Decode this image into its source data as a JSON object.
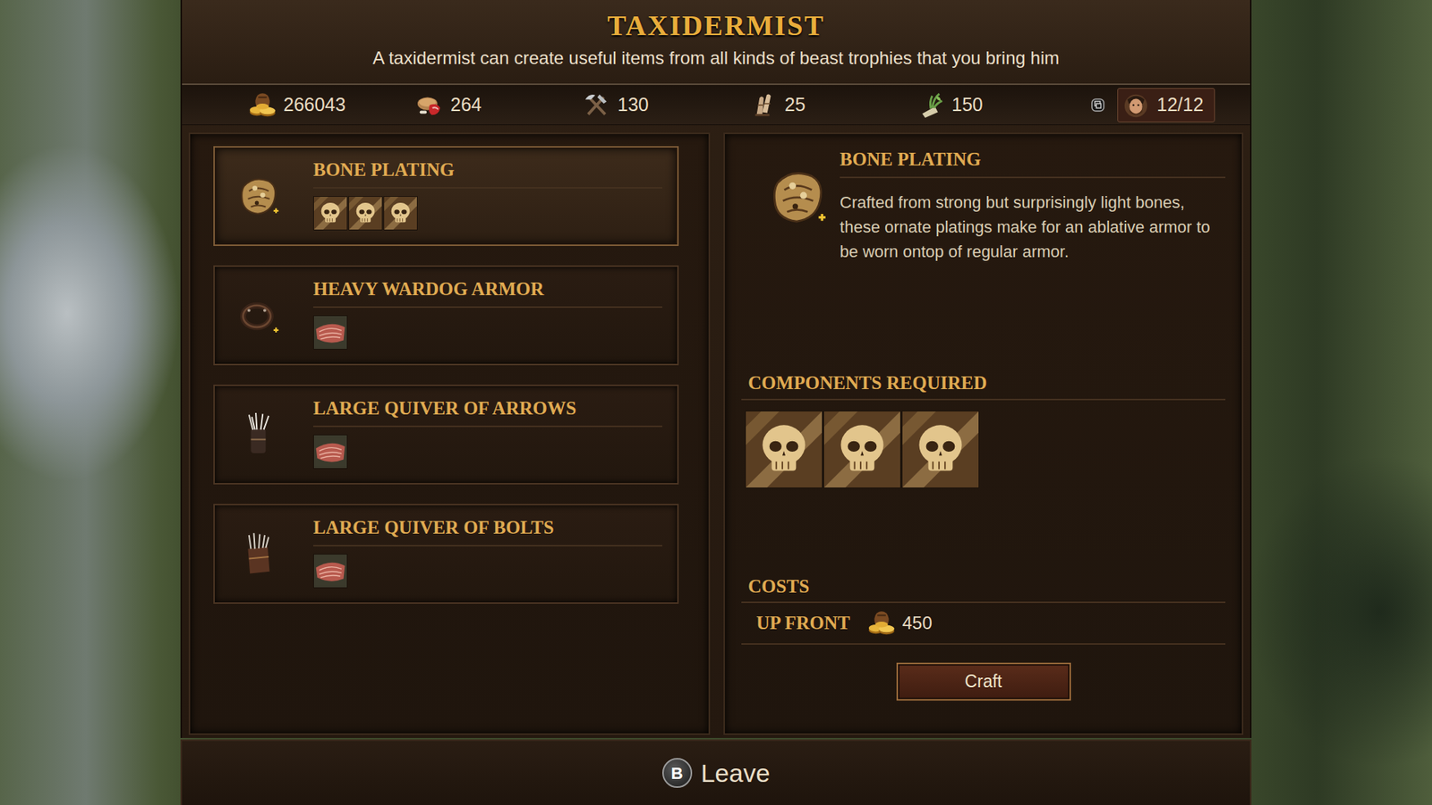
{
  "window": {
    "title": "TAXIDERMIST",
    "subtitle": "A taxidermist can create useful items from all kinds of beast trophies that you bring him"
  },
  "resources": [
    {
      "kind": "crowns",
      "value": "266043"
    },
    {
      "kind": "food",
      "value": "264"
    },
    {
      "kind": "tools",
      "value": "130"
    },
    {
      "kind": "medicine",
      "value": "25"
    },
    {
      "kind": "ammo",
      "value": "150"
    },
    {
      "kind": "roster",
      "value": "12/12"
    }
  ],
  "recipes": [
    {
      "name": "BONE PLATING",
      "kind": "plating",
      "selected": true,
      "components": [
        {
          "kind": "skull"
        },
        {
          "kind": "skull"
        },
        {
          "kind": "skull"
        }
      ]
    },
    {
      "name": "HEAVY WARDOG ARMOR",
      "kind": "dogarmor",
      "selected": false,
      "components": [
        {
          "kind": "hide"
        }
      ]
    },
    {
      "name": "LARGE QUIVER OF ARROWS",
      "kind": "arrows",
      "selected": false,
      "components": [
        {
          "kind": "hide"
        }
      ]
    },
    {
      "name": "LARGE QUIVER OF BOLTS",
      "kind": "bolts",
      "selected": false,
      "components": [
        {
          "kind": "hide"
        }
      ]
    }
  ],
  "detail": {
    "name": "BONE PLATING",
    "kind": "plating",
    "description": "Crafted from strong but surprisingly light bones, these ornate platings make for an ablative armor to be worn ontop of regular armor.",
    "components_title": "COMPONENTS REQUIRED",
    "components": [
      {
        "kind": "skull"
      },
      {
        "kind": "skull"
      },
      {
        "kind": "skull"
      }
    ],
    "costs_title": "COSTS",
    "cost_label": "UP FRONT",
    "cost_value": "450",
    "craft_button": "Craft"
  },
  "footer": {
    "key": "B",
    "label": "Leave"
  }
}
